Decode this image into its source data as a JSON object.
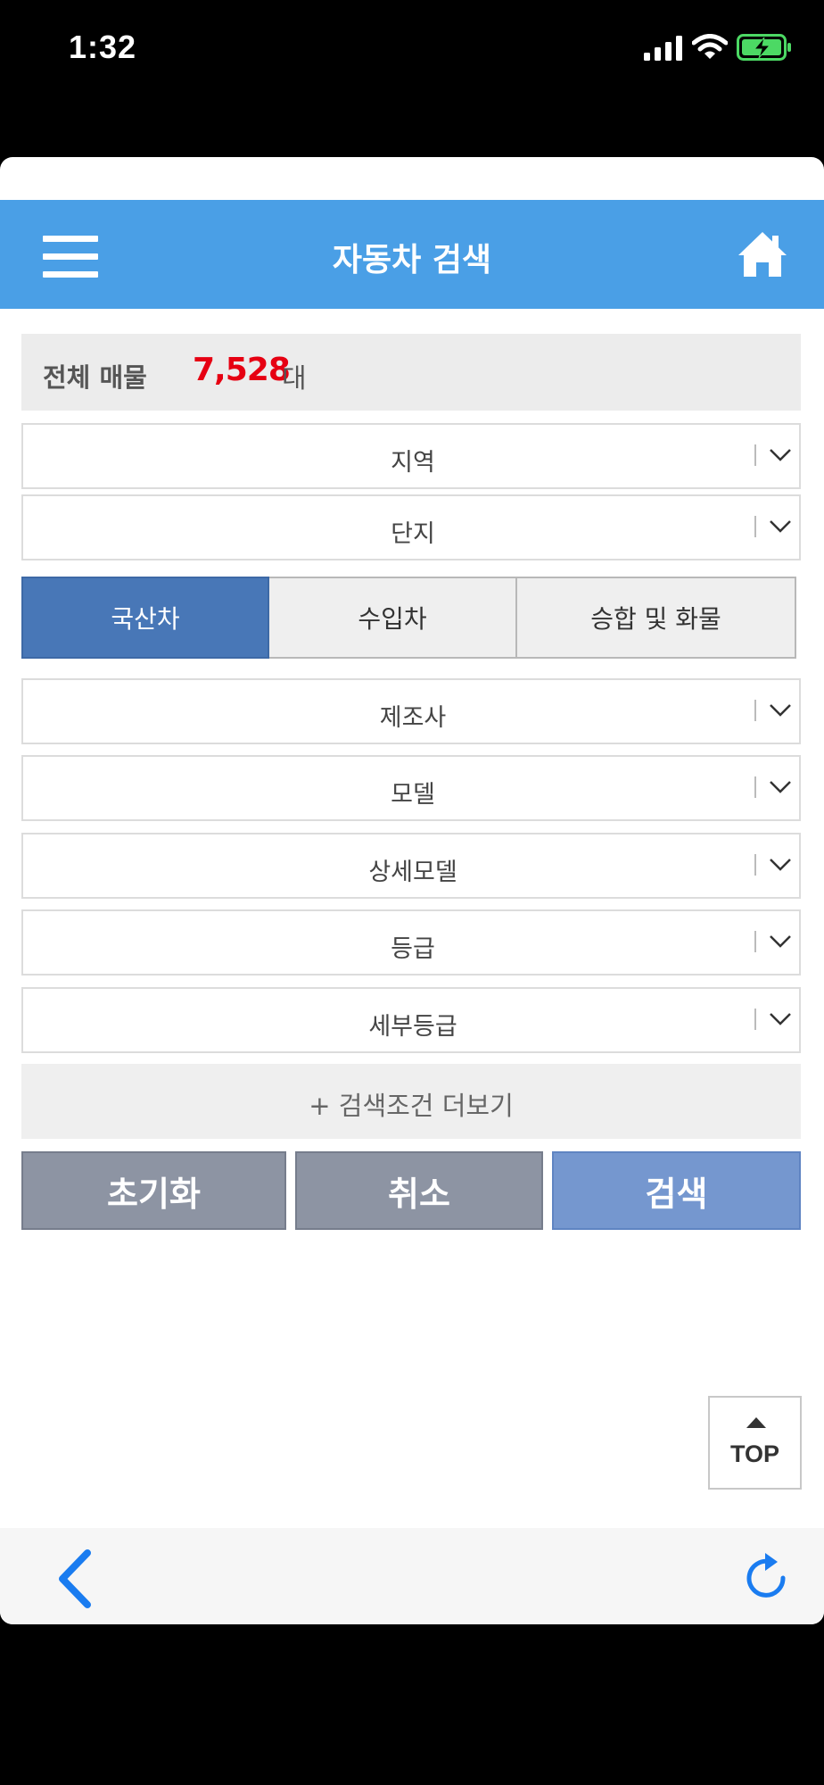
{
  "status_bar": {
    "time": "1:32"
  },
  "header": {
    "title": "자동차 검색"
  },
  "summary": {
    "label": "전체 매물",
    "count": "7,528",
    "unit": "대"
  },
  "filters_top": [
    {
      "label": "지역"
    },
    {
      "label": "단지"
    }
  ],
  "tabs": [
    {
      "label": "국산차",
      "active": true
    },
    {
      "label": "수입차",
      "active": false
    },
    {
      "label": "승합 및 화물",
      "active": false
    }
  ],
  "filters_bottom": [
    {
      "label": "제조사"
    },
    {
      "label": "모델"
    },
    {
      "label": "상세모델"
    },
    {
      "label": "등급"
    },
    {
      "label": "세부등급"
    }
  ],
  "more_conditions": "+ 검색조건 더보기",
  "actions": {
    "reset": "초기화",
    "cancel": "취소",
    "search": "검색"
  },
  "top_button": {
    "label": "TOP"
  },
  "colors": {
    "header": "#4a9fe6",
    "count": "#e60012",
    "tab_active": "#4877b7",
    "search_button": "#7597cf",
    "secondary_button": "#8d94a3",
    "nav_icon": "#1a7cf0"
  }
}
